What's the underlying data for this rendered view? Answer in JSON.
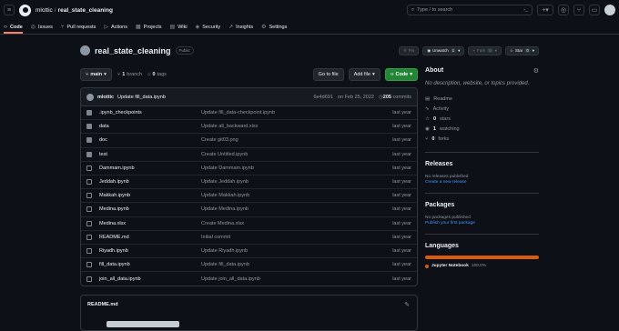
{
  "header": {
    "owner": "mlottic",
    "separator": "/",
    "repo": "real_state_cleaning",
    "search_placeholder": "Type / to search",
    "slash_key": "/"
  },
  "tabs": [
    {
      "label": "Code",
      "icon": "code-icon",
      "glyph": "‹›"
    },
    {
      "label": "Issues",
      "icon": "issue-icon",
      "glyph": "◎"
    },
    {
      "label": "Pull requests",
      "icon": "pull-request-icon",
      "glyph": "⑂"
    },
    {
      "label": "Actions",
      "icon": "play-icon",
      "glyph": "▷"
    },
    {
      "label": "Projects",
      "icon": "table-icon",
      "glyph": "▦"
    },
    {
      "label": "Wiki",
      "icon": "book-icon",
      "glyph": "▤"
    },
    {
      "label": "Security",
      "icon": "shield-icon",
      "glyph": "◈"
    },
    {
      "label": "Insights",
      "icon": "graph-icon",
      "glyph": "↗"
    },
    {
      "label": "Settings",
      "icon": "gear-icon",
      "glyph": "⚙"
    }
  ],
  "repo": {
    "name": "real_state_cleaning",
    "visibility": "Public",
    "pin": "Pin",
    "unwatch": "Unwatch",
    "watch_count": "1",
    "fork": "Fork",
    "fork_count": "0",
    "star": "Star",
    "star_count": "0"
  },
  "toolbar": {
    "branch": "main",
    "branches_count": "1",
    "branches_label": "branch",
    "tags_count": "0",
    "tags_label": "tags",
    "goto_file": "Go to file",
    "add_file": "Add file",
    "code": "Code"
  },
  "latest_commit": {
    "author": "mlottic",
    "message": "Update fill_data.ipynb",
    "hash": "6e4d691",
    "date": "on Feb 25, 2022",
    "commits_count": "205",
    "commits_label": "commits"
  },
  "files": [
    {
      "name": ".ipynb_checkpoints",
      "type": "dir",
      "message": "Update fill_data-checkpoint.ipynb",
      "date": "last year"
    },
    {
      "name": "data",
      "type": "dir",
      "message": "Update all_backward.xlsx",
      "date": "last year"
    },
    {
      "name": "doc",
      "type": "dir",
      "message": "Create git03.png",
      "date": "last year"
    },
    {
      "name": "test",
      "type": "dir",
      "message": "Create Untitled.ipynb",
      "date": "last year"
    },
    {
      "name": "Dammam.ipynb",
      "type": "file",
      "message": "Update Dammam.ipynb",
      "date": "last year"
    },
    {
      "name": "Jeddah.ipynb",
      "type": "file",
      "message": "Update Jeddah.ipynb",
      "date": "last year"
    },
    {
      "name": "Makkah.ipynb",
      "type": "file",
      "message": "Update Makkah.ipynb",
      "date": "last year"
    },
    {
      "name": "Medina.ipynb",
      "type": "file",
      "message": "Update Medina.ipynb",
      "date": "last year"
    },
    {
      "name": "Medina.xlsx",
      "type": "file",
      "message": "Create Medina.xlsx",
      "date": "last year"
    },
    {
      "name": "README.md",
      "type": "file",
      "message": "Initial commit",
      "date": "last year"
    },
    {
      "name": "Riyadh.ipynb",
      "type": "file",
      "message": "Update Riyadh.ipynb",
      "date": "last year"
    },
    {
      "name": "fill_data.ipynb",
      "type": "file",
      "message": "Update fill_data.ipynb",
      "date": "last year"
    },
    {
      "name": "join_all_data.ipynb",
      "type": "file",
      "message": "Update join_all_data.ipynb",
      "date": "last year"
    }
  ],
  "readme": {
    "title": "README.md"
  },
  "about": {
    "title": "About",
    "description": "No description, website, or topics provided.",
    "readme": "Readme",
    "activity": "Activity",
    "stars_count": "0",
    "stars_label": "stars",
    "watching_count": "1",
    "watching_label": "watching",
    "forks_count": "0",
    "forks_label": "forks"
  },
  "releases": {
    "title": "Releases",
    "note": "No releases published",
    "link": "Create a new release"
  },
  "packages": {
    "title": "Packages",
    "note": "No packages published",
    "link": "Publish your first package"
  },
  "languages": {
    "title": "Languages",
    "items": [
      {
        "name": "Jupyter Notebook",
        "percent": "100.0%",
        "share": 1.0,
        "color": "#da5b0b"
      }
    ]
  }
}
